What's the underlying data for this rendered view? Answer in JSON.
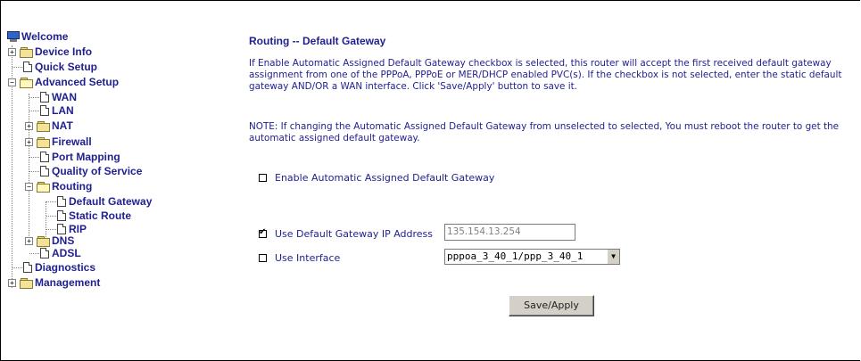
{
  "sidebar": {
    "welcome": "Welcome",
    "items": {
      "device_info": "Device Info",
      "quick_setup": "Quick Setup",
      "advanced_setup": "Advanced Setup",
      "wan": "WAN",
      "lan": "LAN",
      "nat": "NAT",
      "firewall": "Firewall",
      "port_mapping": "Port Mapping",
      "quality_of_service": "Quality of Service",
      "routing": "Routing",
      "default_gateway": "Default Gateway",
      "static_route": "Static Route",
      "rip": "RIP",
      "dns": "DNS",
      "adsl": "ADSL",
      "diagnostics": "Diagnostics",
      "management": "Management"
    },
    "expanders": {
      "collapsed": "+",
      "expanded": "−"
    }
  },
  "main": {
    "title": "Routing -- Default Gateway",
    "description": "If Enable Automatic Assigned Default Gateway checkbox is selected, this router will accept the first received default gateway assignment from one of the PPPoA, PPPoE or MER/DHCP enabled PVC(s). If the checkbox is not selected, enter the static default gateway AND/OR a WAN interface. Click 'Save/Apply' button to save it.",
    "note": "NOTE: If changing the Automatic Assigned Default Gateway from unselected to selected, You must reboot the router to get the automatic assigned default gateway.",
    "auto_gateway": {
      "label": "Enable Automatic Assigned Default Gateway",
      "checked": false
    },
    "gateway_ip": {
      "label": "Use Default Gateway IP Address",
      "checked": true,
      "value": "135.154.13.254"
    },
    "interface": {
      "label": "Use Interface",
      "checked": false,
      "selected": "pppoa_3_40_1/ppp_3_40_1"
    },
    "save_button": "Save/Apply"
  },
  "colors": {
    "text": "#1f1f8f",
    "background": "#ffffff"
  }
}
